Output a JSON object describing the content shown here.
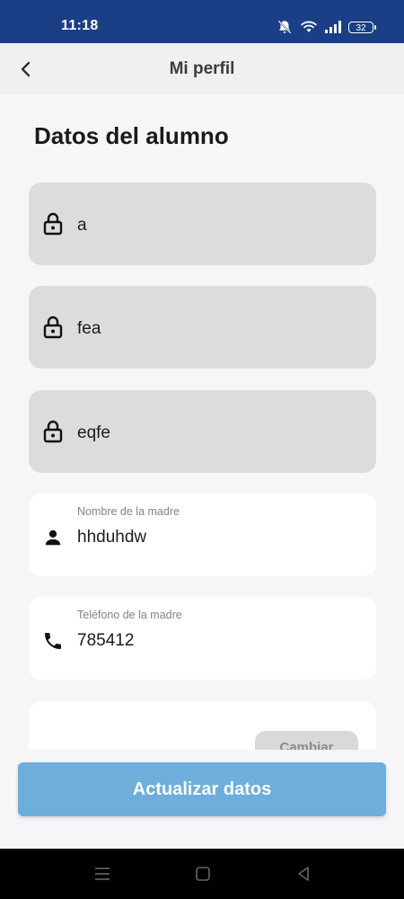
{
  "status_bar": {
    "time": "11:18",
    "battery": "32",
    "icons": [
      "mute-bell-icon",
      "wifi-icon",
      "signal-icon",
      "battery-icon"
    ]
  },
  "app_bar": {
    "title": "Mi perfil",
    "back_icon": "chevron-left-icon"
  },
  "section_title": "Datos del alumno",
  "locked_fields": [
    {
      "value": "a",
      "icon": "lock-icon"
    },
    {
      "value": "fea",
      "icon": "lock-icon"
    },
    {
      "value": "eqfe",
      "icon": "lock-icon"
    }
  ],
  "editable_fields": [
    {
      "label": "Nombre de la madre",
      "value": "hhduhdw",
      "icon": "person-icon"
    },
    {
      "label": "Teléfono de la madre",
      "value": "785412",
      "icon": "phone-icon"
    }
  ],
  "change_button_label": "Cambiar",
  "update_button_label": "Actualizar datos",
  "colors": {
    "status_bar": "#1b3f86",
    "primary_button": "#6daedb",
    "locked_field_bg": "#dcdbde",
    "background": "#f6f6f8"
  },
  "nav_bar": {
    "icons": [
      "menu-icon",
      "home-square-icon",
      "back-triangle-icon"
    ]
  }
}
